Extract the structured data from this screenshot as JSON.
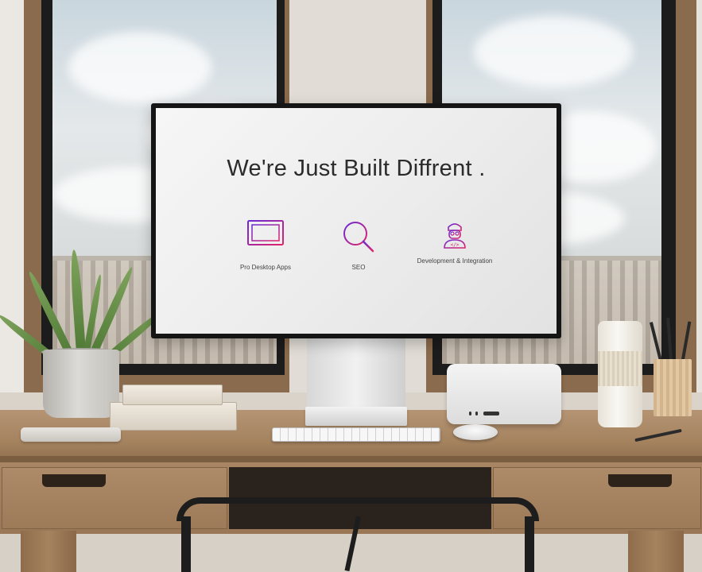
{
  "screen": {
    "headline": "We're Just Built Diffrent .",
    "services": [
      {
        "label": "Pro Desktop Apps",
        "icon": "desktop-monitor-icon"
      },
      {
        "label": "SEO",
        "icon": "magnifier-icon"
      },
      {
        "label": "Development & Integration",
        "icon": "developer-avatar-icon"
      }
    ],
    "colors": {
      "icon_gradient_start": "#6a2bd6",
      "icon_gradient_end": "#e0246a",
      "headline": "#2b2b2b",
      "screen_bg": "#efefef"
    }
  }
}
